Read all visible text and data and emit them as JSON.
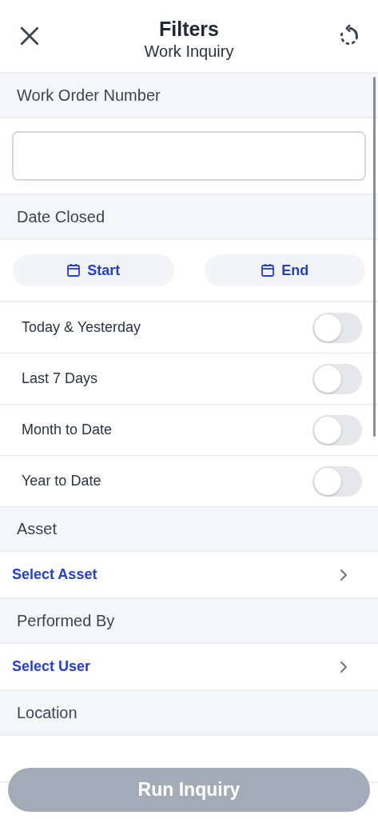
{
  "header": {
    "title": "Filters",
    "subtitle": "Work Inquiry"
  },
  "sections": [
    {
      "kind": "text",
      "title": "Work Order Number"
    },
    {
      "kind": "date",
      "title": "Date Closed",
      "buttons": [
        "Start",
        "End"
      ],
      "presets": [
        {
          "label": "Today & Yesterday",
          "on": false
        },
        {
          "label": "Last 7 Days",
          "on": false
        },
        {
          "label": "Month to Date",
          "on": false
        },
        {
          "label": "Year to Date",
          "on": false
        }
      ]
    },
    {
      "kind": "select",
      "title": "Asset",
      "link": "Select Asset"
    },
    {
      "kind": "select",
      "title": "Performed By",
      "link": "Select User"
    },
    {
      "kind": "select",
      "title": "Location"
    }
  ],
  "run_button": {
    "label": "Run Inquiry",
    "disabled": true
  }
}
